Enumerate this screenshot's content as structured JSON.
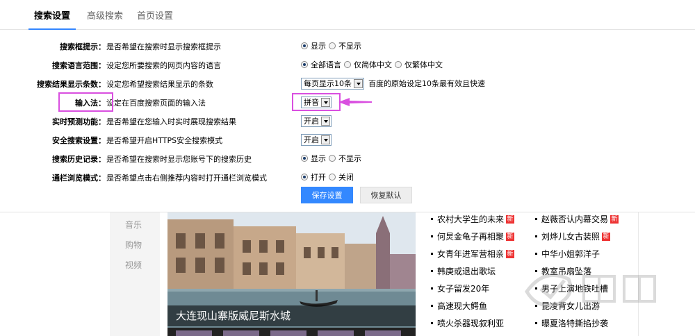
{
  "tabs": [
    "搜索设置",
    "高级搜索",
    "首页设置"
  ],
  "settings": {
    "suggest": {
      "label": "搜索框提示：",
      "desc": "是否希望在搜索时显示搜索框提示",
      "options": [
        "显示",
        "不显示"
      ]
    },
    "language": {
      "label": "搜索语言范围：",
      "desc": "设定您所要搜索的网页内容的语言",
      "options": [
        "全部语言",
        "仅简体中文",
        "仅繁体中文"
      ]
    },
    "results": {
      "label": "搜索结果显示条数：",
      "desc": "设定您希望搜索结果显示的条数",
      "value": "每页显示10条",
      "note": "百度的原始设定10条最有效且快速"
    },
    "ime": {
      "label": "输入法：",
      "desc": "设定在百度搜索页面的输入法",
      "value": "拼音"
    },
    "instant": {
      "label": "实时预测功能：",
      "desc": "是否希望在您输入时实时展现搜索结果",
      "value": "开启"
    },
    "secure": {
      "label": "安全搜索设置：",
      "desc": "是否希望开启HTTPS安全搜索模式",
      "value": "开启"
    },
    "history": {
      "label": "搜索历史记录：",
      "desc": "是否希望在搜索时显示您账号下的搜索历史",
      "options": [
        "显示",
        "不显示"
      ]
    },
    "browse": {
      "label": "通栏浏览模式：",
      "desc": "是否希望点击右侧推荐内容时打开通栏浏览模式",
      "options": [
        "打开",
        "关闭"
      ]
    }
  },
  "buttons": {
    "save": "保存设置",
    "reset": "恢复默认"
  },
  "leftnav": [
    "音乐",
    "购物",
    "视频"
  ],
  "photo_caption": "大连现山寨版威尼斯水城",
  "news_left": [
    {
      "text": "农村大学生的未来",
      "new": "新"
    },
    {
      "text": "何炅金龟子再相聚",
      "new": "新"
    },
    {
      "text": "女青年进军营相亲",
      "new": "新"
    },
    {
      "text": "韩庚或退出歌坛",
      "new": ""
    },
    {
      "text": "女子留发20年",
      "new": ""
    },
    {
      "text": "高速现大鳄鱼",
      "new": ""
    },
    {
      "text": "喷火杀器现叙利亚",
      "new": ""
    }
  ],
  "news_right": [
    {
      "text": "赵薇否认内幕交易",
      "new": "新"
    },
    {
      "text": "刘烨儿女古装照",
      "new": "新"
    },
    {
      "text": "中华小姐郭洋子",
      "new": ""
    },
    {
      "text": "教室吊扇坠落",
      "new": ""
    },
    {
      "text": "男子上演地铁吐槽",
      "new": ""
    },
    {
      "text": "昆凌背女儿出游",
      "new": ""
    },
    {
      "text": "曝夏洛特撕掐抄袭",
      "new": ""
    }
  ],
  "colors": {
    "accent": "#3385ff",
    "highlight": "#d94fe0",
    "new_badge": "#ee3333"
  },
  "icons": {
    "watermark": "baidu-jingyan-watermark-icon"
  }
}
